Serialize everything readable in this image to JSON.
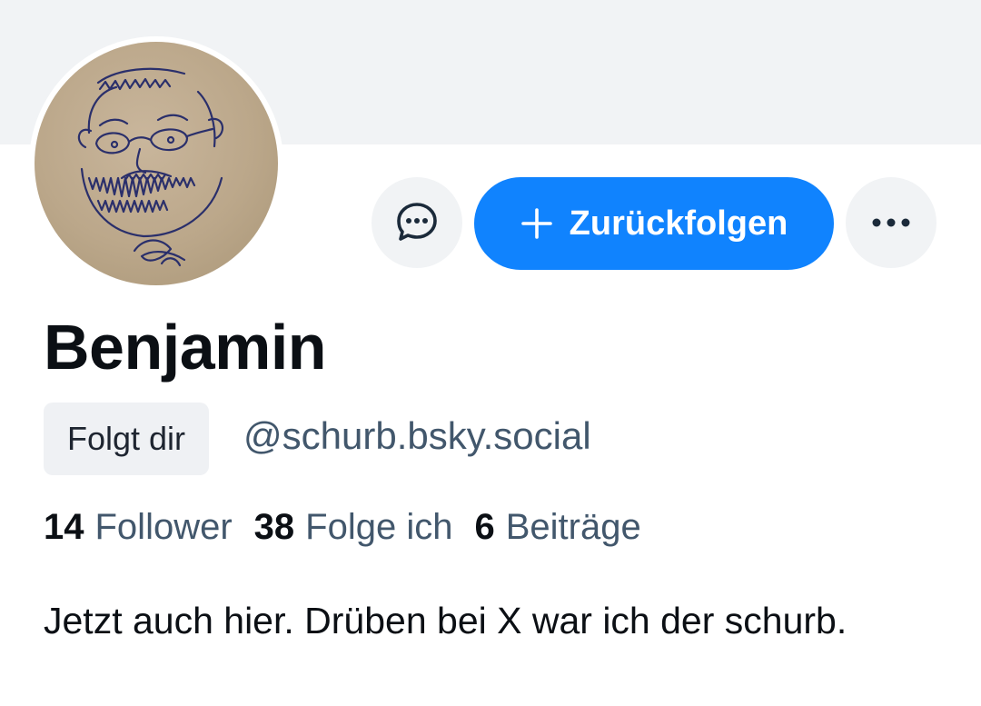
{
  "profile": {
    "display_name": "Benjamin",
    "follows_you_label": "Folgt dir",
    "handle": "@schurb.bsky.social",
    "bio": "Jetzt auch hier. Drüben bei X war ich der schurb."
  },
  "actions": {
    "message_icon": "chat-bubble-icon",
    "follow_back_label": "Zurückfolgen",
    "more_icon": "ellipsis-icon"
  },
  "stats": [
    {
      "count": "14",
      "label": "Follower"
    },
    {
      "count": "38",
      "label": "Folge ich"
    },
    {
      "count": "6",
      "label": "Beiträge"
    }
  ],
  "colors": {
    "accent": "#1083fe",
    "banner": "#f1f3f5",
    "secondary_text": "#42576c"
  }
}
